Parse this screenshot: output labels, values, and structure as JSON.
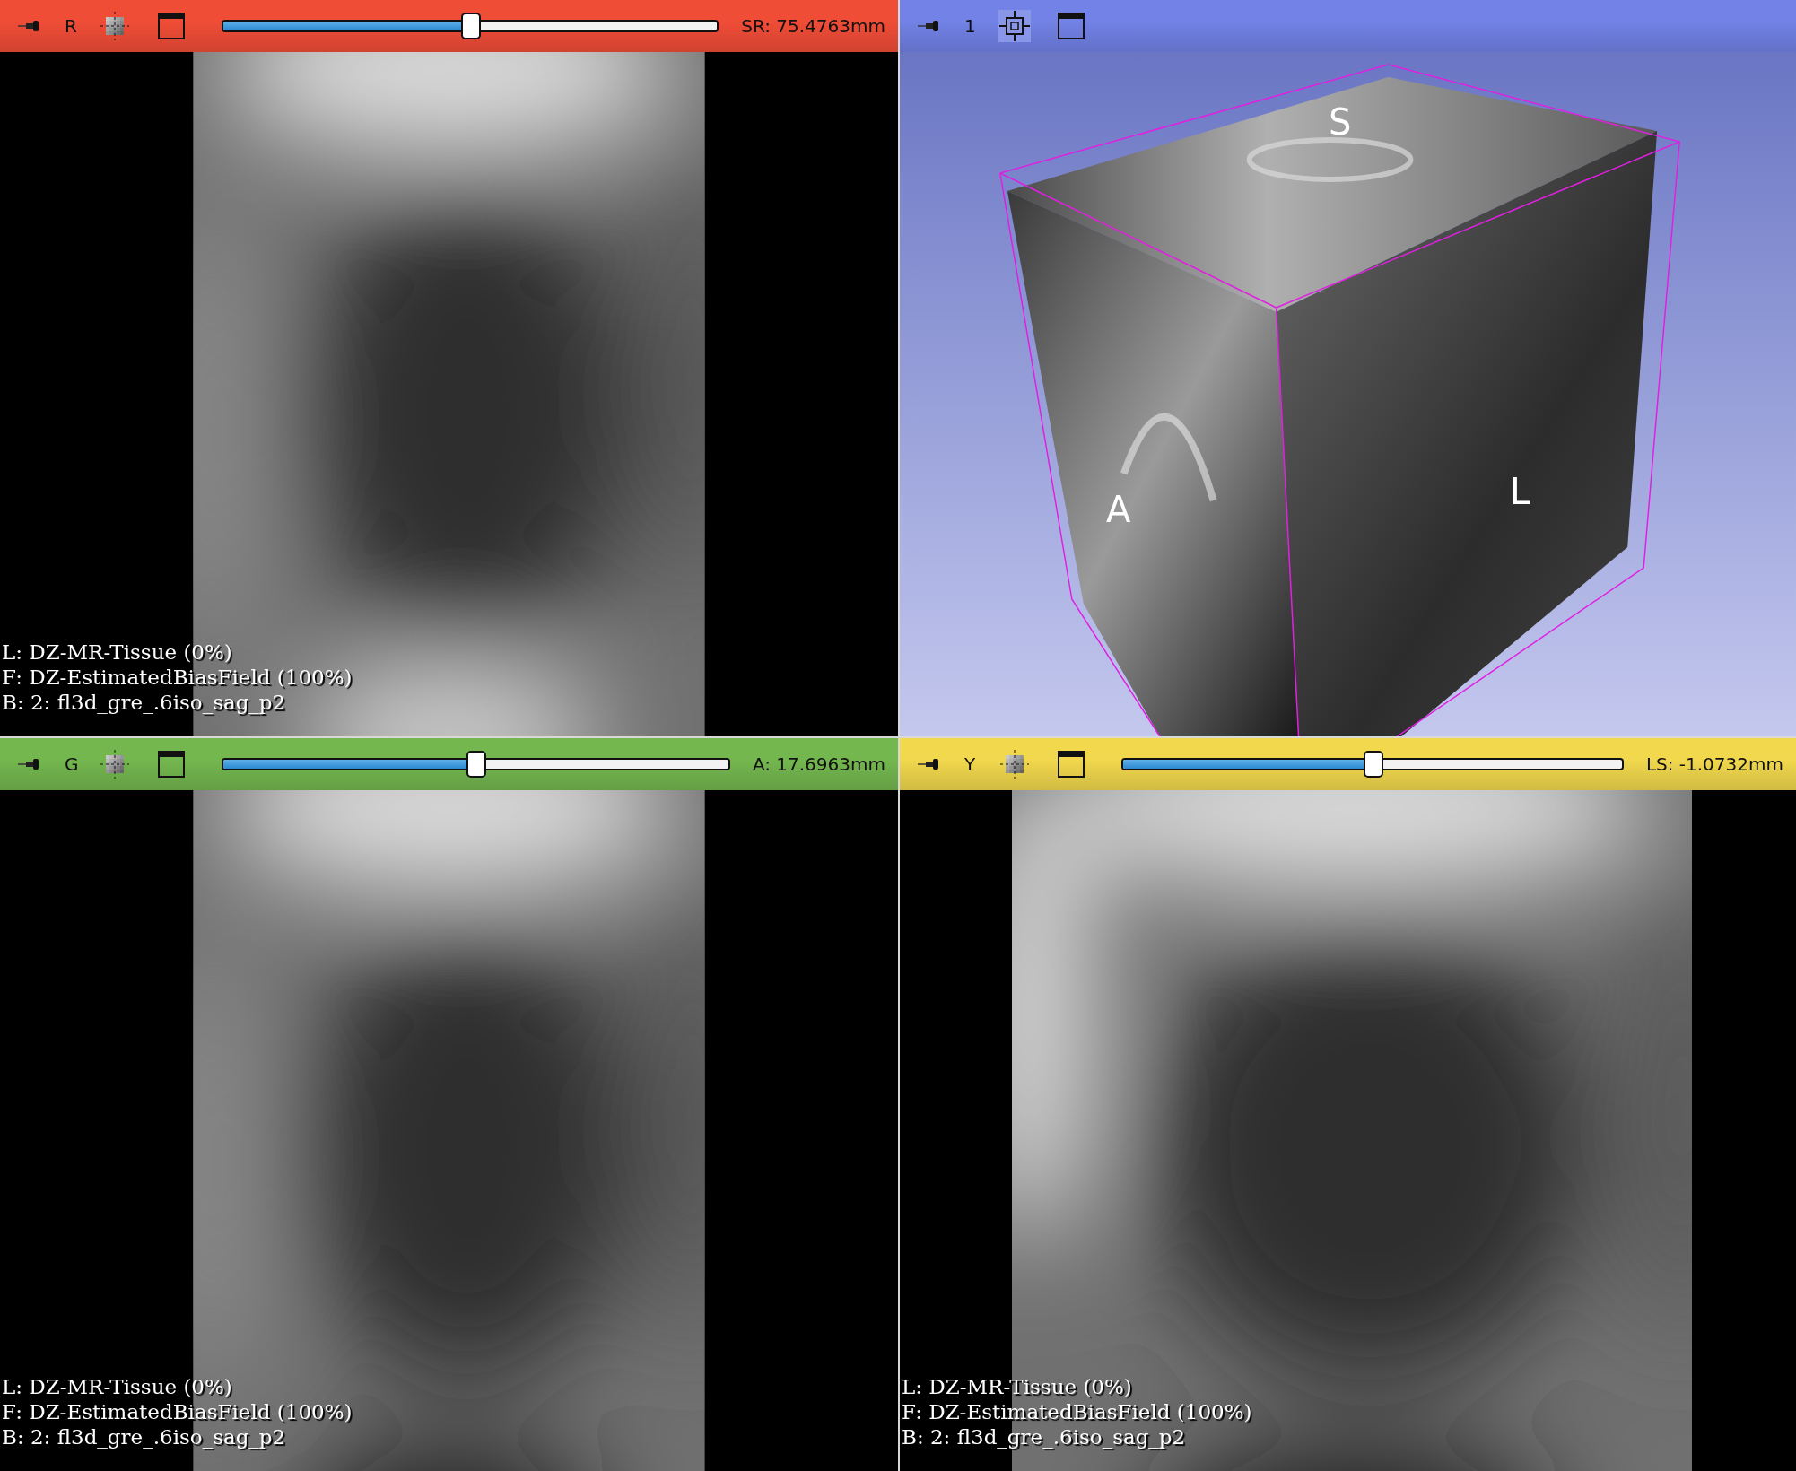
{
  "views": [
    {
      "kind": "slice",
      "color": "#f04d37",
      "label": "R",
      "slider": {
        "level": 0.5,
        "reading": "SR: 75.4763mm"
      },
      "overlay": [
        "L: DZ-MR-Tissue (0%)",
        "F: DZ-EstimatedBiasField (100%)",
        "B: 2: fl3d_gre_.6iso_sag_p2"
      ]
    },
    {
      "kind": "volume",
      "color": "#7282e6",
      "label": "1",
      "orientation_labels": [
        "S",
        "A",
        "L"
      ]
    },
    {
      "kind": "slice",
      "color": "#74b74f",
      "label": "G",
      "slider": {
        "level": 0.5,
        "reading": "A: 17.6963mm"
      },
      "overlay": [
        "L: DZ-MR-Tissue (0%)",
        "F: DZ-EstimatedBiasField (100%)",
        "B: 2: fl3d_gre_.6iso_sag_p2"
      ]
    },
    {
      "kind": "slice",
      "color": "#f1d84d",
      "label": "Y",
      "slider": {
        "level": 0.5,
        "reading": "LS: -1.0732mm"
      },
      "overlay": [
        "L: DZ-MR-Tissue (0%)",
        "F: DZ-EstimatedBiasField (100%)",
        "B: 2: fl3d_gre_.6iso_sag_p2"
      ]
    }
  ]
}
